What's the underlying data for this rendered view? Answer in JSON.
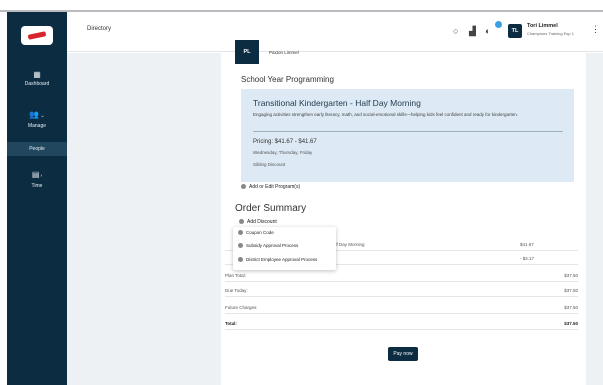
{
  "header": {
    "title": "Directory",
    "user_initials": "TL",
    "user_name": "Tori Limmel",
    "user_org": "Champions Training Esp 1"
  },
  "sidebar": {
    "items": [
      {
        "label": "Dashboard",
        "icon": "dashboard-icon"
      },
      {
        "label": "Manage",
        "icon": "manage-icon"
      },
      {
        "label": "People"
      },
      {
        "label": "Time",
        "icon": "time-icon"
      }
    ],
    "active": "People"
  },
  "student": {
    "initials": "PL",
    "name": "Paxton Limmel"
  },
  "program_section": {
    "title": "School Year Programming",
    "program": {
      "name": "Transitional Kindergarten - Half Day Morning",
      "description": "Engaging activities strengthen early literacy, math, and social-emotional skills—helping kids feel confident and ready for kindergarten.",
      "pricing": "Pricing: $41.67 - $41.67",
      "days": "Wednesday, Thursday, Friday",
      "discount": "Sibling Discount"
    },
    "add_program_label": "Add or Edit Program(s)"
  },
  "order": {
    "title": "Order Summary",
    "add_discount_label": "Add Discount",
    "discount_menu": [
      "Coupon Code",
      "Subsidy Approval Process",
      "District Employee Approval Process"
    ],
    "lines": [
      {
        "label": "– Half Day Morning",
        "value": "$41.67"
      },
      {
        "label": "",
        "value": "- $4.17"
      }
    ],
    "totals": [
      {
        "label": "Plan Total:",
        "value": "$37.50"
      },
      {
        "label": "Due Today:",
        "value": "$37.50"
      },
      {
        "label": "Future Charges:",
        "value": "$37.50"
      },
      {
        "label": "Total:",
        "value": "$37.50"
      }
    ],
    "pay_label": "Pay now"
  },
  "colors": {
    "navy": "#0c2c42",
    "program_bg": "#dde9f4",
    "notification": "#3aa0e6",
    "logo_red": "#d6262b"
  }
}
